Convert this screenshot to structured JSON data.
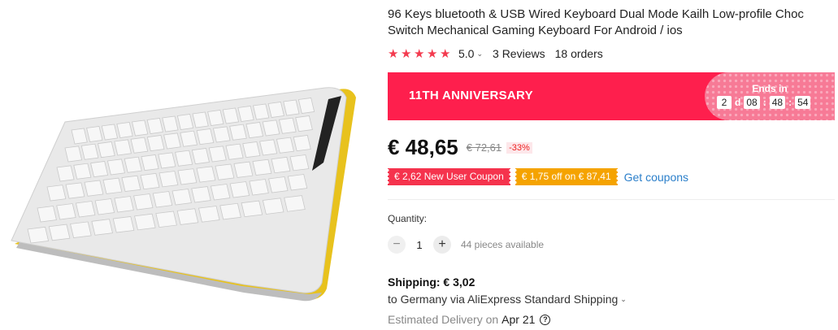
{
  "product": {
    "title": "96 Keys bluetooth & USB Wired Keyboard Dual Mode Kailh Low-profile Choc Switch Mechanical Gaming Keyboard For Android / ios",
    "rating": "5.0",
    "reviews": "3 Reviews",
    "orders": "18 orders",
    "star_count": 5
  },
  "promo": {
    "title": "11TH ANNIVERSARY",
    "ends_label": "Ends in",
    "days": "2",
    "days_unit": "d",
    "hours": "08",
    "minutes": "48",
    "seconds": "54",
    "sep": ":"
  },
  "price": {
    "current": "€ 48,65",
    "original": "€ 72,61",
    "discount": "-33%"
  },
  "coupons": {
    "new_user": "€ 2,62 New User Coupon",
    "off": "€ 1,75 off on € 87,41",
    "get_label": "Get coupons"
  },
  "quantity": {
    "label": "Quantity:",
    "value": "1",
    "minus": "−",
    "plus": "+",
    "available": "44 pieces available"
  },
  "shipping": {
    "title": "Shipping: € 3,02",
    "route": "to Germany via AliExpress Standard Shipping",
    "estimated_label": "Estimated Delivery on",
    "date": "Apr 21"
  },
  "colors": {
    "promo_red": "#fe1f4d",
    "star": "#f33b4f",
    "coupon_red": "#f5334d",
    "coupon_orange": "#f5a300",
    "link_blue": "#2b7fca"
  }
}
